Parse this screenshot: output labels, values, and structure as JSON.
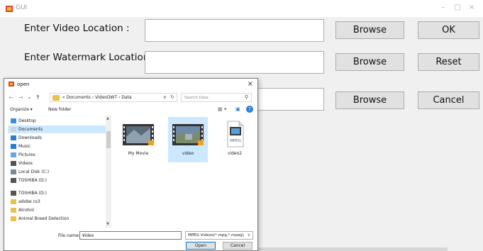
{
  "window": {
    "title": "GUI"
  },
  "form": {
    "video_label": "Enter Video Location :",
    "watermark_label": "Enter Watermark Location :",
    "browse_label": "Browse",
    "ok_label": "OK",
    "reset_label": "Reset",
    "cancel_label": "Cancel"
  },
  "dialog": {
    "title": "open",
    "breadcrumb": "« Documents  ›  VideoDWT  ›  Data",
    "search_placeholder": "Search Data",
    "organize_label": "Organize ▾",
    "new_folder_label": "New folder",
    "nav_items": [
      {
        "label": "Desktop",
        "icon": "desktop-icon",
        "color": "#3a8ee6"
      },
      {
        "label": "Documents",
        "icon": "documents-icon",
        "color": "#c9d3de",
        "selected": true
      },
      {
        "label": "Downloads",
        "icon": "downloads-icon",
        "color": "#2b7cd3"
      },
      {
        "label": "Music",
        "icon": "music-icon",
        "color": "#2b7cd3"
      },
      {
        "label": "Pictures",
        "icon": "pictures-icon",
        "color": "#6ba7d8"
      },
      {
        "label": "Videos",
        "icon": "videos-icon",
        "color": "#555555"
      },
      {
        "label": "Local Disk (C:)",
        "icon": "disk-icon",
        "color": "#7a8a99"
      },
      {
        "label": "TOSHIBA (D:)",
        "icon": "drive-icon",
        "color": "#555555"
      },
      {
        "label": "TOSHIBA (D:)",
        "icon": "drive-icon",
        "color": "#555555"
      },
      {
        "label": "adobe cs3",
        "icon": "folder-icon",
        "color": "#e8c14e"
      },
      {
        "label": "Alcohol",
        "icon": "folder-icon",
        "color": "#e8c14e"
      },
      {
        "label": "Animal Breed Detection",
        "icon": "folder-icon",
        "color": "#e8c14e"
      }
    ],
    "files": [
      {
        "name": "My Movie",
        "icon": "video-file-icon"
      },
      {
        "name": "video",
        "icon": "video-file-icon",
        "selected": true
      },
      {
        "name": "video2",
        "icon": "mpeg-file-icon"
      }
    ],
    "mpeg_text": "MPEG",
    "filename_label": "File name:",
    "filename_value": "video",
    "filter_value": "MPEG Videos(*.mpg,*.mpeg)",
    "open_label": "Open",
    "cancel_label": "Cancel"
  },
  "colors": {
    "selection": "#cce8ff",
    "folder": "#e8c14e",
    "accent": "#0078d7"
  }
}
